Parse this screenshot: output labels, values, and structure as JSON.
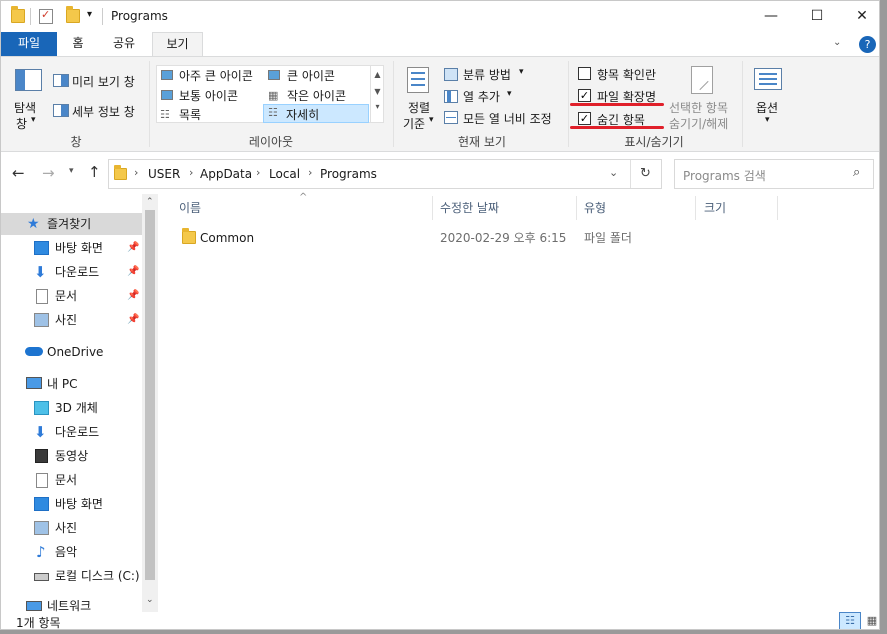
{
  "window": {
    "title": "Programs",
    "controls": {
      "minimize": "—",
      "maximize": "☐",
      "close": "✕"
    }
  },
  "ribbon_tabs": [
    "파일",
    "홈",
    "공유",
    "보기"
  ],
  "ribbon": {
    "pane": {
      "nav_pane": "탐색",
      "nav_pane2": "창",
      "preview": "미리 보기 창",
      "details": "세부 정보 창",
      "group": "창"
    },
    "layout": {
      "items": [
        "아주 큰 아이콘",
        "큰 아이콘",
        "보통 아이콘",
        "작은 아이콘",
        "목록",
        "자세히"
      ],
      "selected": "자세히",
      "group": "레이아웃"
    },
    "current_view": {
      "sort_by": "정렬",
      "sort_by2": "기준",
      "group_by": "분류 방법",
      "add_columns": "열 추가",
      "size_all_columns": "모든 열 너비 조정",
      "group": "현재 보기"
    },
    "show_hide": {
      "item_checkboxes": "항목 확인란",
      "item_checkboxes_checked": "false",
      "file_extensions": "파일 확장명",
      "file_extensions_checked": "true",
      "hidden_items": "숨긴 항목",
      "hidden_items_checked": "true",
      "hide_selected": "선택한 항목",
      "hide_selected2": "숨기기/해제",
      "group": "표시/숨기기"
    },
    "options": "옵션"
  },
  "address": {
    "path": [
      "USER",
      "AppData",
      "Local",
      "Programs"
    ],
    "search_placeholder": "Programs 검색"
  },
  "nav": {
    "quick_access": "즐겨찾기",
    "quick_items": [
      "바탕 화면",
      "다운로드",
      "문서",
      "사진"
    ],
    "onedrive": "OneDrive",
    "this_pc": "내 PC",
    "pc_items": [
      "3D 개체",
      "다운로드",
      "동영상",
      "문서",
      "바탕 화면",
      "사진",
      "음악",
      "로컬 디스크 (C:)"
    ],
    "network": "네트워크"
  },
  "columns": [
    "이름",
    "수정한 날짜",
    "유형",
    "크기"
  ],
  "files": [
    {
      "name": "Common",
      "modified": "2020-02-29 오후 6:15",
      "type": "파일 폴더",
      "size": ""
    }
  ],
  "status": {
    "count": "1개 항목"
  },
  "colors": {
    "accent": "#1966b8",
    "selected_bg": "#cce8ff",
    "highlight": "#e0202a"
  }
}
